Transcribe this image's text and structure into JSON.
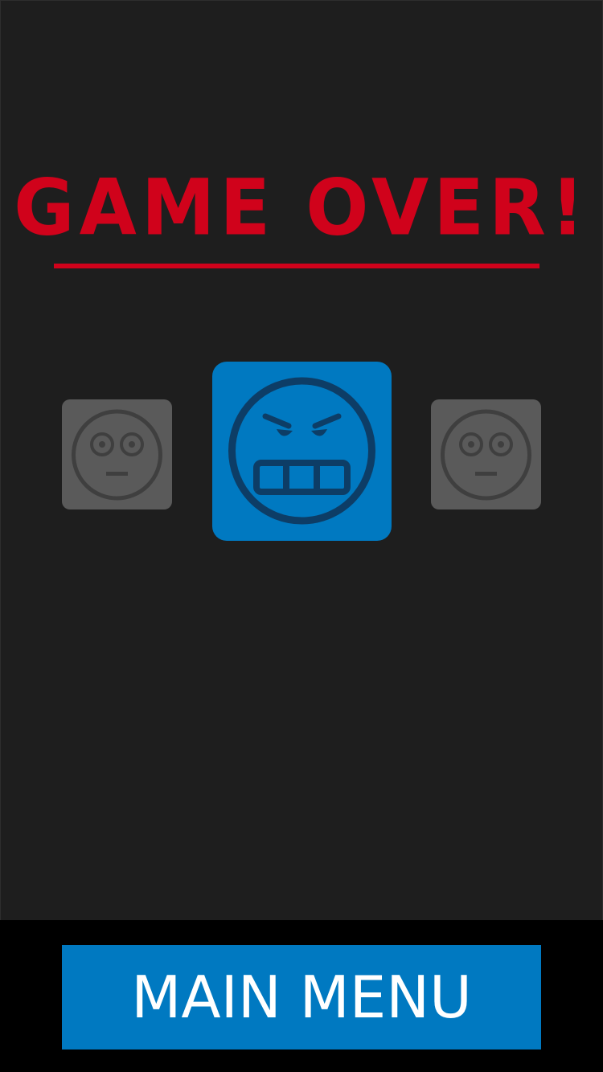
{
  "screen": {
    "title": "GAME OVER!",
    "tiles": [
      {
        "icon": "neutral-face-icon",
        "state": "inactive",
        "color": "#5a5a5a"
      },
      {
        "icon": "angry-face-icon",
        "state": "selected",
        "color": "#0079c1"
      },
      {
        "icon": "neutral-face-icon",
        "state": "inactive",
        "color": "#5a5a5a"
      }
    ],
    "main_menu_label": "MAIN MENU"
  },
  "colors": {
    "background": "#1e1e1e",
    "title_red": "#d0021b",
    "accent_blue": "#0079c1",
    "tile_gray": "#5a5a5a",
    "footer": "#000000"
  }
}
